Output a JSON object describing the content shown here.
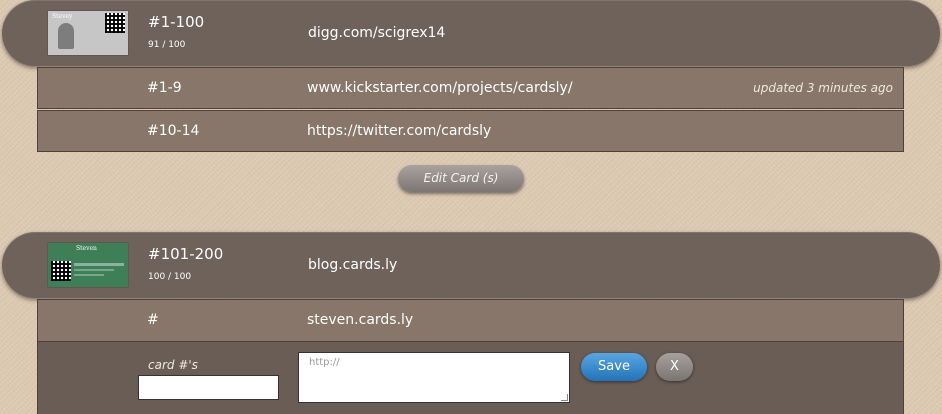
{
  "group1": {
    "range": "#1-100",
    "count": "91 / 100",
    "url": "digg.com/scigrex14",
    "thumb_name": "Stevey",
    "rows": [
      {
        "range": "#1-9",
        "url": "www.kickstarter.com/projects/cardsly/",
        "updated": "updated 3 minutes ago"
      },
      {
        "range": "#10-14",
        "url": "https://twitter.com/cardsly",
        "updated": ""
      }
    ]
  },
  "edit_button_label": "Edit Card (s)",
  "group2": {
    "range": "#101-200",
    "count": "100 / 100",
    "url": "blog.cards.ly",
    "thumb_name": "Steven",
    "rows": [
      {
        "range": "#",
        "url": "steven.cards.ly"
      }
    ]
  },
  "edit_form": {
    "card_label": "card #'s",
    "card_value": "",
    "url_placeholder": "http://",
    "save_label": "Save",
    "cancel_label": "X"
  },
  "colors": {
    "pill": "#6f625b",
    "row": "#877669",
    "save": "#2a7fc4"
  }
}
